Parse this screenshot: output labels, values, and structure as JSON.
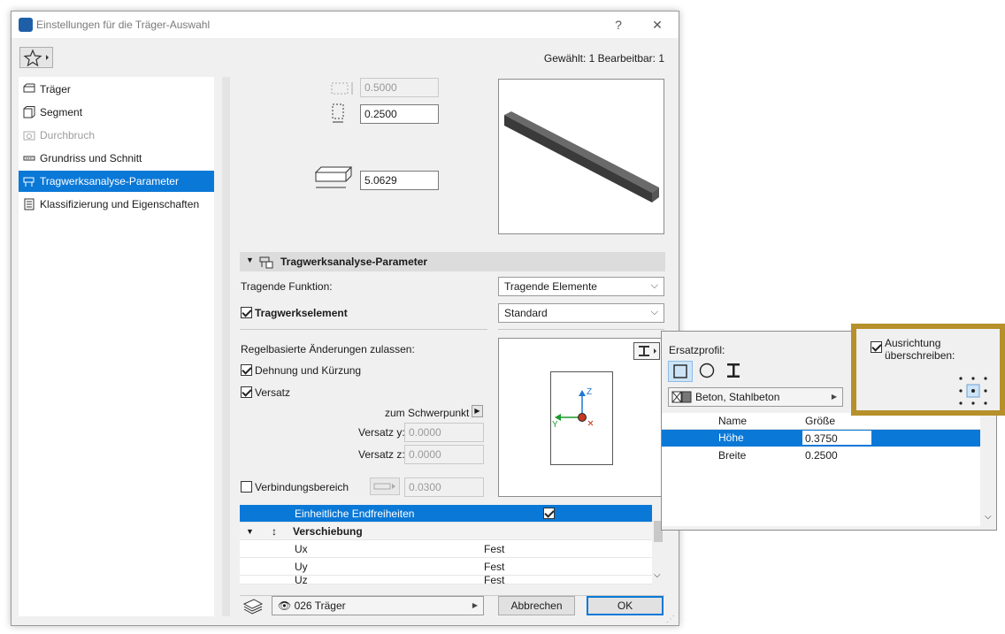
{
  "window": {
    "title": "Einstellungen für die Träger-Auswahl",
    "help_glyph": "?",
    "close_glyph": "✕"
  },
  "selection_info": "Gewählt: 1 Bearbeitbar: 1",
  "sidebar": {
    "items": [
      {
        "label": "Träger",
        "icon": "beam-icon",
        "state": "normal"
      },
      {
        "label": "Segment",
        "icon": "segment-icon",
        "state": "normal"
      },
      {
        "label": "Durchbruch",
        "icon": "hole-icon",
        "state": "disabled"
      },
      {
        "label": "Grundriss und Schnitt",
        "icon": "floorplan-icon",
        "state": "normal"
      },
      {
        "label": "Tragwerksanalyse-Parameter",
        "icon": "structural-icon",
        "state": "active"
      },
      {
        "label": "Klassifizierung und Eigenschaften",
        "icon": "classification-icon",
        "state": "normal"
      }
    ]
  },
  "geometry": {
    "width_value": "0.5000",
    "height_value": "0.2500",
    "length_value": "5.0629"
  },
  "section": {
    "title": "Tragwerksanalyse-Parameter",
    "tragende_funktion_label": "Tragende Funktion:",
    "tragende_funktion_value": "Tragende Elemente",
    "tragwerkselement_label": "Tragwerkselement",
    "tragwerkselement_checked": true,
    "tragwerkselement_value": "Standard",
    "regel_label": "Regelbasierte Änderungen zulassen:",
    "dehnung_label": "Dehnung und Kürzung",
    "dehnung_checked": true,
    "versatz_label": "Versatz",
    "versatz_checked": true,
    "schwerpunkt_label": "zum Schwerpunkt",
    "versatz_y_label": "Versatz y:",
    "versatz_y_value": "0.0000",
    "versatz_z_label": "Versatz z:",
    "versatz_z_value": "0.0000",
    "verbindung_label": "Verbindungsbereich",
    "verbindung_checked": false,
    "verbindung_value": "0.0300",
    "axis_z": "Z",
    "axis_y": "Y"
  },
  "table": {
    "rows": [
      {
        "col1": "Einheitliche Endfreiheiten",
        "col2": "",
        "selected": true,
        "checkbox": true
      },
      {
        "col1": "Verschiebung",
        "col2": "",
        "group": true
      },
      {
        "col1": "Ux",
        "col2": "Fest"
      },
      {
        "col1": "Uy",
        "col2": "Fest"
      },
      {
        "col1": "Uz",
        "col2": "Fest"
      }
    ]
  },
  "footer": {
    "layer_value": "026 Träger",
    "cancel_label": "Abbrechen",
    "ok_label": "OK"
  },
  "popup": {
    "ersatzprofil_label": "Ersatzprofil:",
    "material_value": "Beton, Stahlbeton",
    "col_name": "Name",
    "col_groesse": "Größe",
    "rows": [
      {
        "name": "Höhe",
        "value": "0.3750",
        "selected": true
      },
      {
        "name": "Breite",
        "value": "0.2500",
        "selected": false
      }
    ]
  },
  "ausrichtung": {
    "label_line1": "Ausrichtung",
    "label_line2": "überschreiben:",
    "checked": true
  },
  "colors": {
    "accent": "#0a78d7",
    "highlight_border": "#b6902b"
  }
}
